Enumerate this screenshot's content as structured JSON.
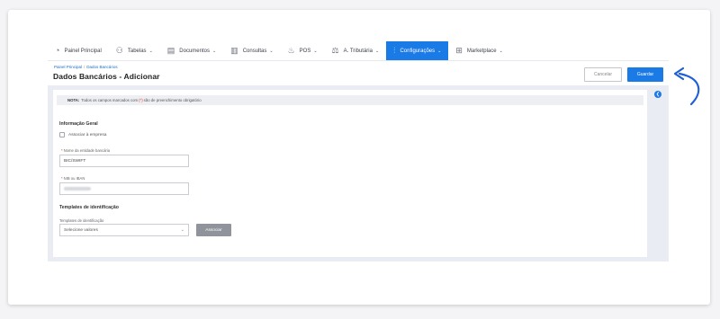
{
  "nav": {
    "items": [
      {
        "label": "Painel Principal",
        "icon": "dashboard-icon",
        "has_dropdown": false
      },
      {
        "label": "Tabelas",
        "icon": "users-icon",
        "has_dropdown": true
      },
      {
        "label": "Documentos",
        "icon": "document-icon",
        "has_dropdown": true
      },
      {
        "label": "Consultas",
        "icon": "bar-chart-icon",
        "has_dropdown": true
      },
      {
        "label": "POS",
        "icon": "pos-icon",
        "has_dropdown": true
      },
      {
        "label": "A. Tributária",
        "icon": "tax-authority-icon",
        "has_dropdown": true
      },
      {
        "label": "Configurações",
        "icon": "settings-sliders-icon",
        "has_dropdown": true,
        "active": true
      },
      {
        "label": "Marketplace",
        "icon": "marketplace-icon",
        "has_dropdown": true
      }
    ]
  },
  "breadcrumb": {
    "home": "Painel Principal",
    "current": "Dados Bancários"
  },
  "page": {
    "title": "Dados Bancários - Adicionar"
  },
  "actions": {
    "cancel_label": "Cancelar",
    "save_label": "Guardar"
  },
  "note": {
    "prefix": "NOTA:",
    "text_before": "Todos os campos marcados com",
    "required_marker": "(*)",
    "text_after": "são de preenchimento obrigatório"
  },
  "general_info": {
    "title": "Informação Geral",
    "checkbox_label": "Associar à empresa",
    "bank_name_label": "Nome da entidade bancária",
    "bank_name_value": "BIC/SWIFT",
    "nib_label": "NIB ou IBAN",
    "nib_value": "",
    "required_marker": "*"
  },
  "templates": {
    "title": "Templates de identificação",
    "select_label": "Templates de identificação",
    "select_placeholder": "Selecione valores",
    "associate_label": "Associar"
  },
  "colors": {
    "accent": "#1a7ae6",
    "background": "#e9ecf2",
    "required": "#dd3333",
    "disabled_button": "#8f939c"
  }
}
